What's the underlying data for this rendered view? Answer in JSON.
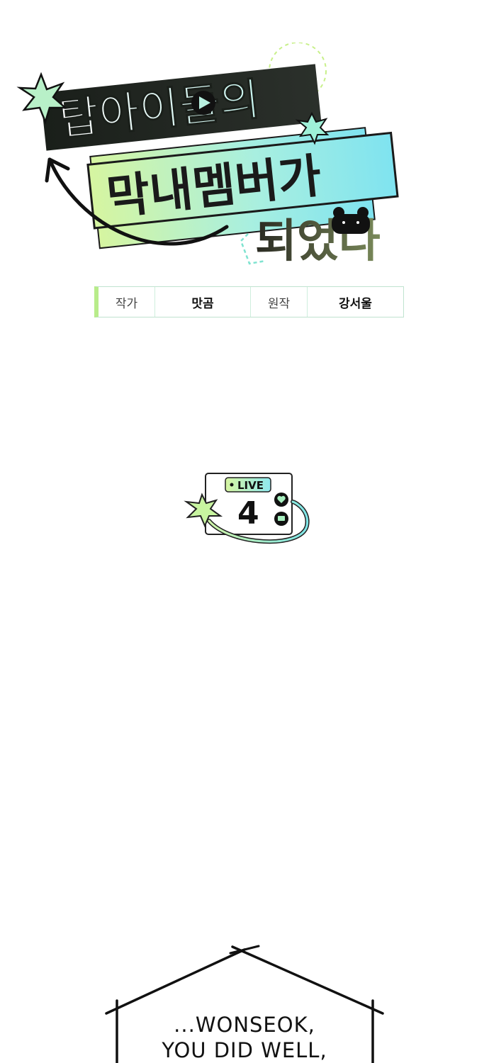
{
  "title": {
    "line1": "탑아이돌의",
    "line2": "막내멤버가",
    "line3": "되었다"
  },
  "credits": {
    "author_label": "작가",
    "author_value": "맛곰",
    "original_label": "원작",
    "original_value": "강서울"
  },
  "episode": {
    "live_label": "LIVE",
    "number": "4"
  },
  "speech": {
    "line1": "...WONSEOK,",
    "line2": "YOU DID WELL,"
  },
  "colors": {
    "accent_mint": "#7de8c8",
    "accent_lime": "#c8f08a",
    "ink": "#111111"
  },
  "icons": [
    "sparkle-star-icon",
    "play-icon",
    "bear-face-icon",
    "heart-icon",
    "chat-icon",
    "curved-arrow-icon"
  ]
}
